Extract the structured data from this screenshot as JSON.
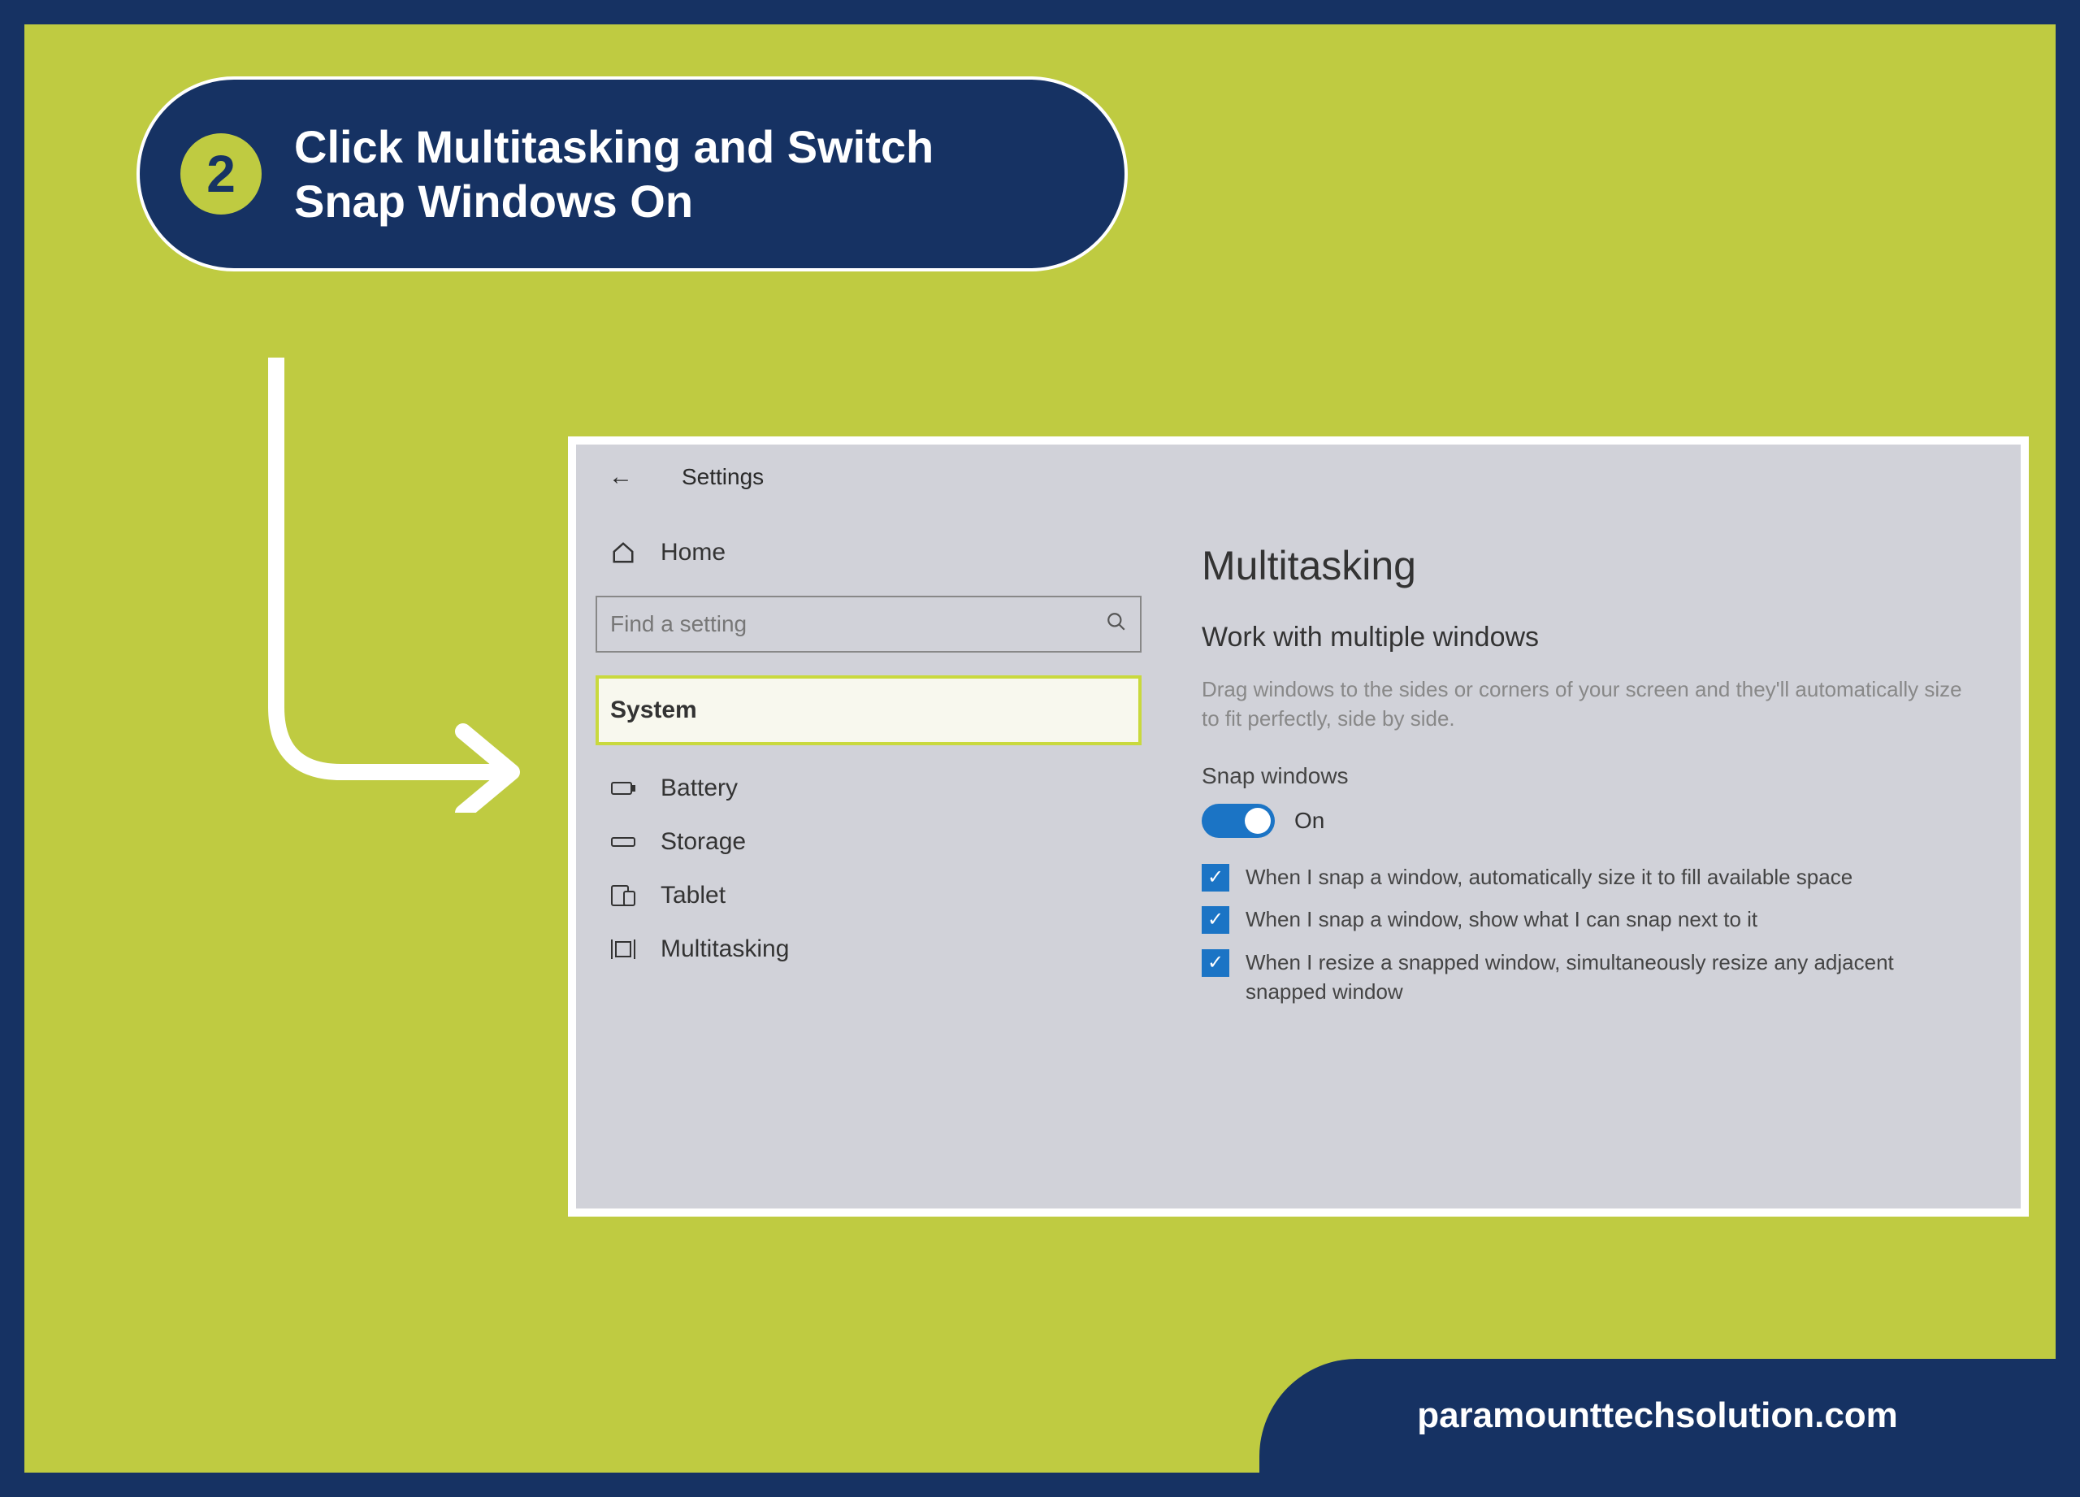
{
  "step": {
    "number": "2",
    "title_line1": "Click Multitasking and Switch",
    "title_line2": "Snap Windows On"
  },
  "settings": {
    "back": "←",
    "title": "Settings",
    "home": "Home",
    "search_placeholder": "Find a setting",
    "sidebar": [
      {
        "label": "System"
      },
      {
        "label": "Battery"
      },
      {
        "label": "Storage"
      },
      {
        "label": "Tablet"
      },
      {
        "label": "Multitasking"
      }
    ],
    "main": {
      "heading": "Multitasking",
      "subheading": "Work with multiple windows",
      "description": "Drag windows to the sides or corners of your screen and they'll automatically size to fit perfectly, side by side.",
      "snap_label": "Snap windows",
      "toggle_state": "On",
      "checks": [
        "When I snap a window, automatically size it to fill available space",
        "When I snap a window, show what I can snap next to it",
        "When I resize a snapped window, simultaneously resize any adjacent snapped window"
      ]
    }
  },
  "footer": "paramounttechsolution.com"
}
